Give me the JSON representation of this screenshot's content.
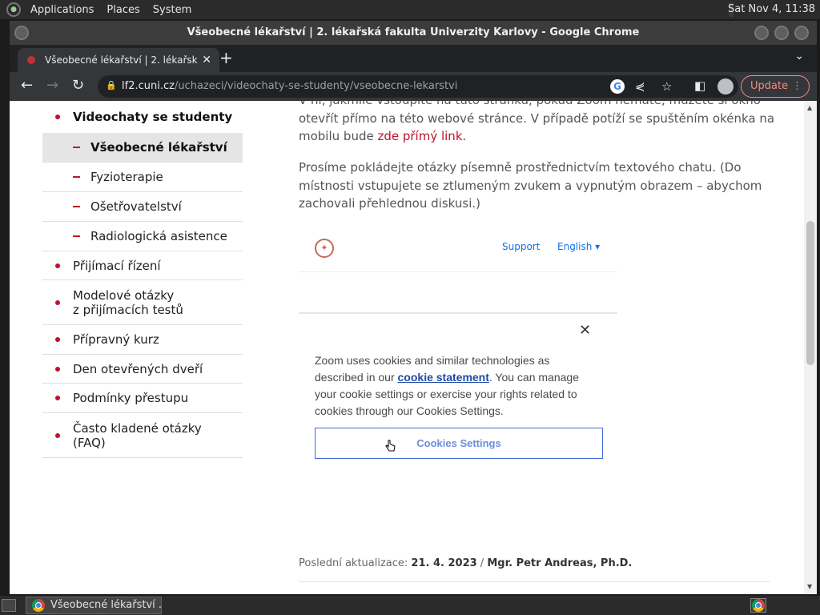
{
  "desktop": {
    "menus": [
      "Applications",
      "Places",
      "System"
    ],
    "clock": "Sat Nov 4, 11:38"
  },
  "window": {
    "title": "Všeobecné lékařství | 2. lékařská fakulta Univerzity Karlovy - Google Chrome"
  },
  "browser": {
    "tab_title": "Všeobecné lékařství | 2. lékařsk",
    "url_host": "lf2.cuni.cz",
    "url_path": "/uchazeci/videochaty-se-studenty/vseobecne-lekarstvi",
    "update_label": "Update"
  },
  "sidebar": {
    "items": [
      {
        "label": "Videochaty se studenty"
      },
      {
        "label": "Všeobecné lékařství"
      },
      {
        "label": "Fyzioterapie"
      },
      {
        "label": "Ošetřovatelství"
      },
      {
        "label": "Radiologická asistence"
      },
      {
        "label": "Přijímací řízení"
      },
      {
        "label": "Modelové otázky"
      },
      {
        "label": "z přijímacích testů"
      },
      {
        "label": "Přípravný kurz"
      },
      {
        "label": "Den otevřených dveří"
      },
      {
        "label": "Podmínky přestupu"
      },
      {
        "label": "Často kladené otázky"
      },
      {
        "label": "(FAQ)"
      }
    ]
  },
  "content": {
    "p1_cut": "V ní, jakmile vstoupíte na tuto stránku, pokud Zoom nemáte, můžete si okno",
    "p1_line2": "otevřít přímo na této webové stránce. V případě potíží se spuštěním okénka na",
    "p1_line3_prefix": "mobilu bude ",
    "p1_link": "zde přímý link",
    "p1_line3_suffix": ".",
    "p2": "Prosíme pokládejte otázky písemně prostřednictvím textového chatu. (Do místnosti vstupujete se ztlumeným zvukem a vypnutým obrazem – abychom zachovali přehlednou diskusi.)"
  },
  "zoom": {
    "support": "Support",
    "language": "English",
    "cookie_text_1": "Zoom uses cookies and similar technologies as described in our ",
    "cookie_link": "cookie statement",
    "cookie_text_2": ". You can manage your cookie settings or exercise your rights related to cookies through our Cookies Settings.",
    "cookies_settings_button": "Cookies Settings"
  },
  "footer": {
    "label": "Poslední aktualizace: ",
    "date": "21. 4. 2023",
    "sep": " / ",
    "author": "Mgr. Petr Andreas, Ph.D."
  },
  "taskbar": {
    "task_label": "Všeobecné lékařství ..."
  }
}
